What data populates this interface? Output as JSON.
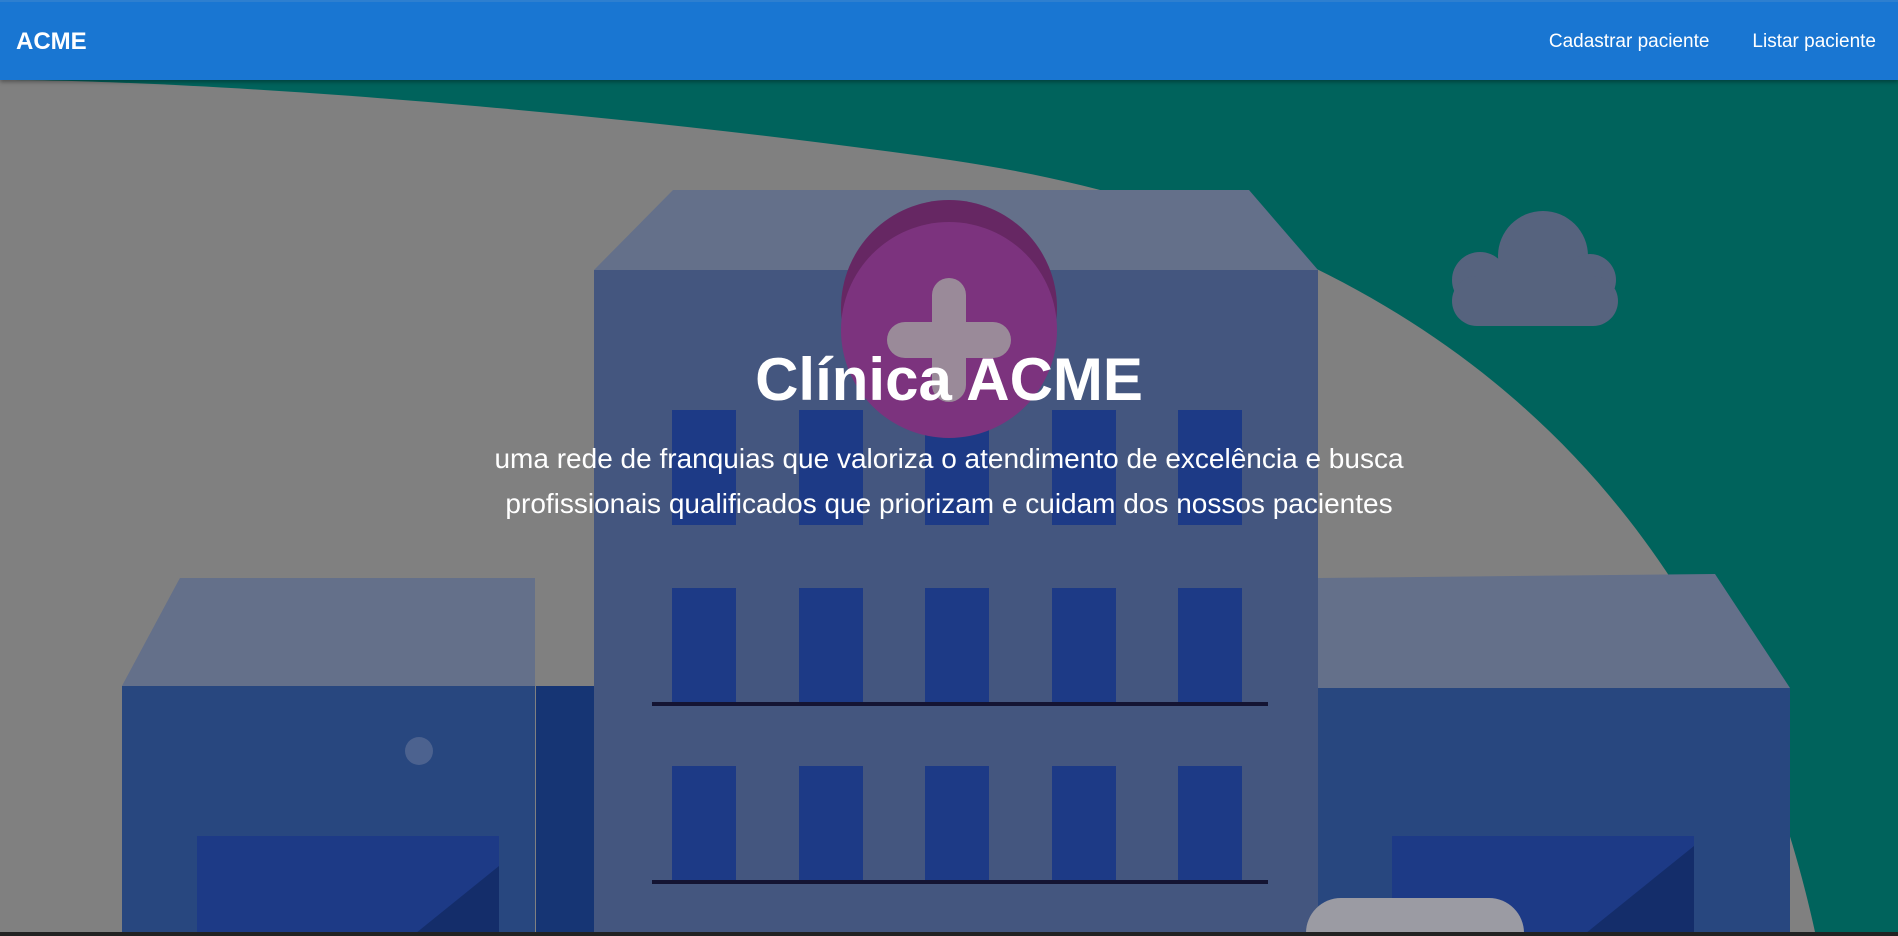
{
  "navbar": {
    "brand": "ACME",
    "links": [
      {
        "label": "Cadastrar paciente"
      },
      {
        "label": "Listar paciente"
      }
    ]
  },
  "hero": {
    "title": "Clínica ACME",
    "subtitle": "uma rede de franquias que valoriza o atendimento de excelência e busca profissionais qualificados que priorizam e cuidam dos nossos pacientes",
    "illustration": "hospital-building",
    "overlay": "dark-translucent"
  },
  "colors": {
    "navbar": "#1976d2",
    "teal_background": "#00635c",
    "hill": "#808080",
    "building": "#44567f",
    "window": "#1d3a86",
    "medical_circle": "#7c337e"
  }
}
